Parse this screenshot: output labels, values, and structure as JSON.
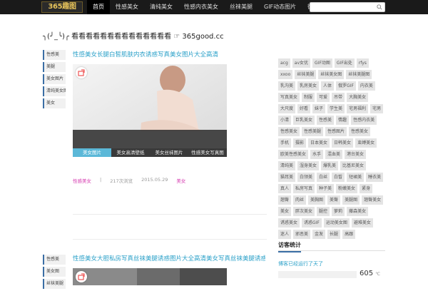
{
  "header": {
    "logo": "365趣图",
    "nav": [
      "首页",
      "性感美女",
      "清纯美女",
      "性感内衣美女",
      "丝袜美腿",
      "GIF动态图片",
      "微博美女"
    ],
    "search_placeholder": ""
  },
  "heading": "╮(╯_╰)╭ 看看看看看看看看看看看看看看 ☞ 365good.cc",
  "posts": [
    {
      "tags": [
        "性感美",
        "美腿",
        "美女图片",
        "清纯美女图",
        "美女"
      ],
      "title": "性感美女长腿白皙肌肤内衣诱惑写真美女图片大全高清",
      "tabs": [
        "美女图片",
        "美女高清壁纸",
        "美女丝袜图片",
        "性感美女写真图"
      ],
      "category": "性感美女",
      "views": "217次浏览",
      "date": "2015.05.29",
      "tag": "美女"
    },
    {
      "tags": [
        "性感美",
        "美女图",
        "丝袜美腿"
      ],
      "title": "性感美女大胆私房写真丝袜美腿诱惑图片大全高清美女写真丝袜美腿诱惑图片大全美女图片高清写真诱惑"
    }
  ],
  "tag_cloud": [
    "acg",
    "av女优",
    "GIF动图",
    "GIF出处",
    "rfys",
    "xxoo",
    "丝袜美腿",
    "丝袜美女图",
    "丝袜美腿图",
    "乳沟美",
    "乳房美女",
    "人体",
    "俄罗GIF",
    "内衣美",
    "写真美女",
    "制服",
    "可爱",
    "吊带",
    "大胸美女",
    "大尺度",
    "好看",
    "妹子",
    "学生美",
    "宅男福利",
    "宅男",
    "小清",
    "巨乳美女",
    "性感美",
    "情趣",
    "性感内衣美",
    "性感美女",
    "性感美腿",
    "性感图片",
    "性感美女",
    "手机",
    "摄影",
    "日本美女",
    "日韩美女",
    "束缚美女",
    "欧美性感美女",
    "水手",
    "混血美",
    "港台美女",
    "清纯美",
    "湿身美女",
    "爆乳美",
    "比基尼美女",
    "猫耳美",
    "白领美",
    "白丝",
    "白皙",
    "短裙美",
    "睡衣美",
    "真人",
    "私房写真",
    "种子美",
    "粉嫩美女",
    "紧身",
    "翘臀",
    "肉丝",
    "美胸图",
    "美臀",
    "美腿图",
    "翘臀美女",
    "美女",
    "胖次美女",
    "腿控",
    "萝莉",
    "藤森美女",
    "诱惑美女",
    "诱惑GIF",
    "运动美女图",
    "避难美女",
    "迷人",
    "邪恶美",
    "金发",
    "长腿",
    "高跟"
  ],
  "widget": {
    "title": "访客统计",
    "subtitle": "博客已经运行了天了",
    "temp_value": "605",
    "temp_unit": "℃"
  },
  "colors": {
    "accent": "#2aa0c8",
    "tag_pink": "#d63ab0",
    "border_blue": "#3a6ea5"
  }
}
